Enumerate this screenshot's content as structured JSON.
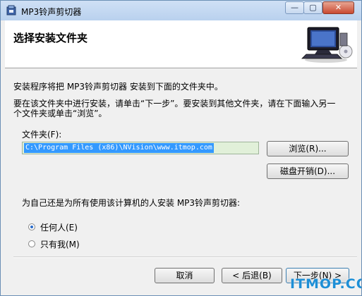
{
  "window": {
    "title": "MP3铃声剪切器",
    "controls": {
      "minimize": "—",
      "maximize": "▢",
      "close": "✕"
    }
  },
  "header": {
    "title": "选择安装文件夹",
    "art_icon": "computer-setup-icon"
  },
  "main": {
    "intro_line": "安装程序将把 MP3铃声剪切器 安装到下面的文件夹中。",
    "instruction_line1": "要在该文件夹中进行安装，请单击“下一步”。要安装到其他文件夹，请在下面输入另一",
    "instruction_line2": "个文件夹或单击“浏览”。",
    "folder_label": "文件夹(F):",
    "folder_value": "C:\\Program Files (x86)\\NVision\\www.itmop.com",
    "browse_button": "浏览(R)...",
    "disk_cost_button": "磁盘开销(D)...",
    "install_for_question": "为自己还是为所有使用该计算机的人安装 MP3铃声剪切器:",
    "radio_options": [
      {
        "label": "任何人(E)",
        "selected": true
      },
      {
        "label": "只有我(M)",
        "selected": false
      }
    ]
  },
  "footer": {
    "cancel_button": "取消",
    "back_button": "< 后退(B)",
    "next_button": "下一步(N) >"
  },
  "watermark": "ITMOP.COM",
  "colors": {
    "titlebar": "#c4d9f1",
    "selection": "#3399ff",
    "field_bg": "#e1f0d9",
    "watermark": "#1e8fd6"
  }
}
